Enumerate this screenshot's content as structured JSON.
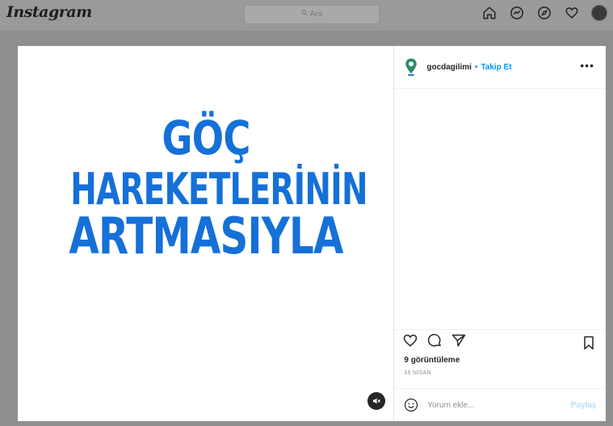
{
  "topbar": {
    "logo": "Instagram",
    "search_placeholder": "Ara",
    "icons": [
      "home-icon",
      "messenger-icon",
      "explore-icon",
      "heart-icon",
      "profile-avatar"
    ]
  },
  "post": {
    "media": {
      "lines": [
        "GÖÇ",
        "HAREKETLERİNİN",
        "ARTMASIYLA"
      ],
      "text_color": "#1570d8"
    },
    "header": {
      "username": "gocdagilimi",
      "separator": "•",
      "follow_label": "Takip Et",
      "more_label": "•••"
    },
    "views": "9 görüntüleme",
    "date": "16 NİSAN",
    "comment_placeholder": "Yorum ekle...",
    "post_button": "Paylaş",
    "colors": {
      "accent": "#0095f6",
      "follow": "#0095f6"
    }
  }
}
